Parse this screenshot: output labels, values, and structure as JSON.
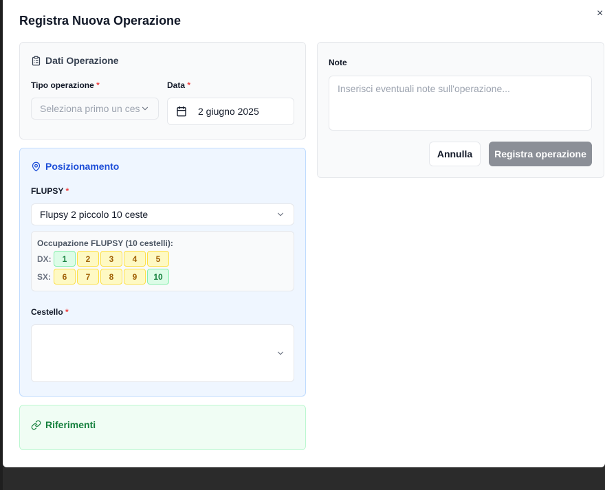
{
  "modal": {
    "title": "Registra Nuova Operazione",
    "close_icon": "×"
  },
  "dati": {
    "title": "Dati Operazione",
    "icon": "clipboard-icon",
    "tipo_label": "Tipo operazione",
    "tipo_placeholder": "Seleziona primo un ces",
    "data_label": "Data",
    "data_value": "2 giugno 2025",
    "required_mark": "*"
  },
  "posizionamento": {
    "title": "Posizionamento",
    "icon": "map-pin-icon",
    "flupsy_label": "FLUPSY",
    "flupsy_value": "Flupsy 2 piccolo 10 ceste",
    "occupazione_title": "Occupazione FLUPSY (10 cestelli):",
    "rows": [
      {
        "side": "DX:",
        "cells": [
          {
            "n": "1",
            "status": "free"
          },
          {
            "n": "2",
            "status": "busy"
          },
          {
            "n": "3",
            "status": "busy"
          },
          {
            "n": "4",
            "status": "busy"
          },
          {
            "n": "5",
            "status": "busy"
          }
        ]
      },
      {
        "side": "SX:",
        "cells": [
          {
            "n": "6",
            "status": "busy"
          },
          {
            "n": "7",
            "status": "busy"
          },
          {
            "n": "8",
            "status": "busy"
          },
          {
            "n": "9",
            "status": "busy"
          },
          {
            "n": "10",
            "status": "free"
          }
        ]
      }
    ],
    "cestello_label": "Cestello",
    "cestello_value": ""
  },
  "riferimenti": {
    "title": "Riferimenti",
    "icon": "link-icon"
  },
  "note": {
    "label": "Note",
    "placeholder": "Inserisci eventuali note sull'operazione...",
    "cancel_label": "Annulla",
    "submit_label": "Registra operazione"
  },
  "colors": {
    "free": "#dcfce7",
    "busy": "#fef9c3",
    "pos_accent": "#1d4ed8",
    "rif_accent": "#15803d",
    "submit_bg": "#8b8f97"
  }
}
